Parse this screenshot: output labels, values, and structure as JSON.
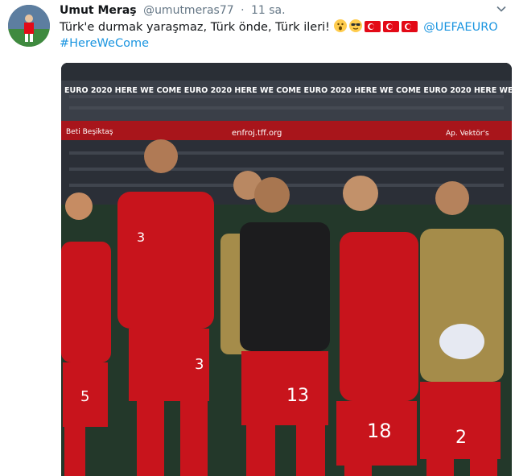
{
  "tweet": {
    "author_name": "Umut Meraş",
    "author_handle": "@umutmeras77",
    "separator": "·",
    "timestamp": "11 sa.",
    "text": "Türk'e durmak yaraşmaz, Türk önde, Türk ileri!",
    "mention": "@UEFAEURO",
    "hashtag": "#HereWeCome"
  },
  "media": {
    "banner_text": "EURO 2020 HERE WE COME EURO 2020 HERE WE COME EURO 2020 HERE WE COME EURO 2020 HERE WE COME",
    "ad_board_text": "enfroj.tff.org",
    "ad_board_left": "Beti Beşiktaş",
    "ad_board_right": "Ap. Vektör's",
    "shirt_numbers": [
      "5",
      "3",
      "13",
      "18",
      "2",
      "3"
    ]
  },
  "colors": {
    "link": "#1b95e0",
    "secondary_text": "#657786",
    "turkey_red": "#e30a17",
    "kit_red": "#c8141c",
    "kit_dark": "#1c1c1e",
    "bib": "#a58c4a"
  },
  "icons": [
    "chevron-down-icon",
    "astonished-face-icon",
    "sunglasses-face-icon",
    "turkey-flag-icon"
  ]
}
